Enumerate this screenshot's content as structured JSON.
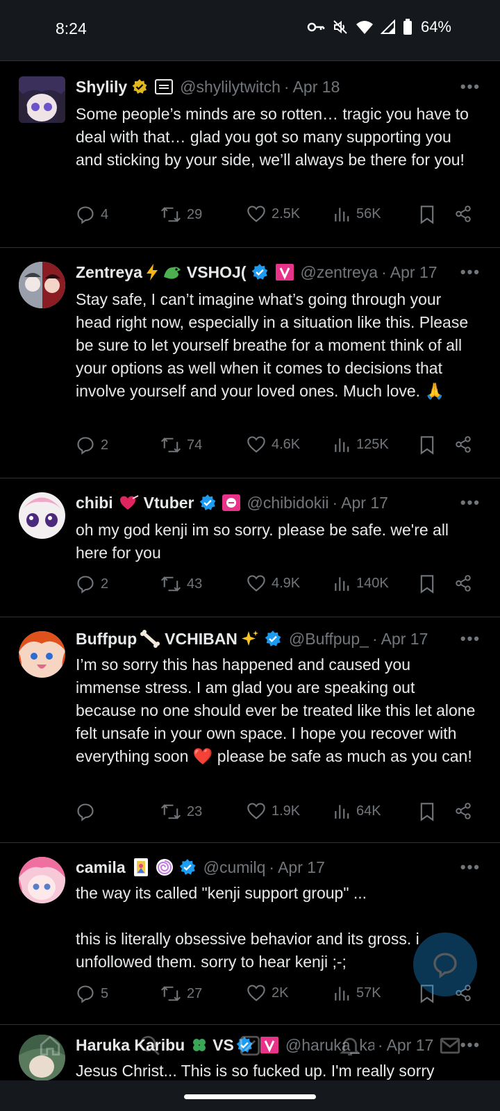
{
  "status": {
    "time": "8:24",
    "battery": "64%"
  },
  "tweets": [
    {
      "name": "Shylily",
      "handle": "@shylilytwitch",
      "date": "Apr 18",
      "text": "Some people’s minds are so rotten… tragic you have to deal with that… glad you got so many supporting you and sticking by your side, we’ll always be there for you!",
      "replies": "4",
      "reposts": "29",
      "likes": "2.5K",
      "views": "56K"
    },
    {
      "name": "Zentreya",
      "name_suffix": "VSHOJ(",
      "handle": "@zentreya",
      "date": "Apr 17",
      "text": "Stay safe, I can’t imagine what’s going through your head right now, especially in a situation like this. Please be sure to let yourself breathe for a moment think of all your options as well when it comes to decisions that involve yourself and your loved ones. Much love. 🙏",
      "replies": "2",
      "reposts": "74",
      "likes": "4.6K",
      "views": "125K"
    },
    {
      "name": "chibi",
      "name_suffix": "Vtuber",
      "handle": "@chibidokii",
      "date": "Apr 17",
      "text": "oh my god kenji im so sorry. please be safe. we're all here for you",
      "replies": "2",
      "reposts": "43",
      "likes": "4.9K",
      "views": "140K"
    },
    {
      "name": "Buffpup",
      "name_suffix": "VCHIBAN",
      "handle": "@Buffpup_",
      "date": "Apr 17",
      "text": "I’m so sorry this has happened and caused you immense stress. I am glad you are speaking out because no one should ever be treated like this let alone felt unsafe in your own space. I hope you recover with everything soon ❤️ please be safe as much as you can!",
      "replies": "",
      "reposts": "23",
      "likes": "1.9K",
      "views": "64K"
    },
    {
      "name": "camila",
      "handle": "@cumilq",
      "date": "Apr 17",
      "text": "the way its called \"kenji support group\" ...\n\nthis is literally obsessive behavior and its gross. i unfollowed them. sorry to hear kenji ;-;",
      "replies": "5",
      "reposts": "27",
      "likes": "2K",
      "views": "57K"
    },
    {
      "name": "Haruka Karibu",
      "name_suffix": "VS",
      "handle": "@haruka_ka",
      "date": "Apr 17",
      "text": "Jesus Christ... This is so fucked up. I'm really sorry"
    }
  ],
  "colors": {
    "background": "#000000",
    "text": "#e7e9ea",
    "muted": "#71767b",
    "verified": "#1d9bf0",
    "gold": "#e2b719",
    "divider": "#2f3336"
  }
}
